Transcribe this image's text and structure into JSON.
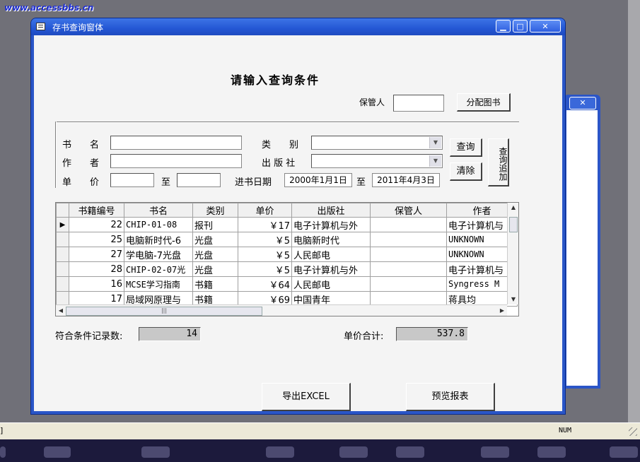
{
  "watermark": "www.accessbbs.cn",
  "window": {
    "title": "存书查询窗体",
    "controls": {
      "minimize": "▁",
      "maximize": "□",
      "close": "✕"
    }
  },
  "bg_window": {
    "close": "✕"
  },
  "form": {
    "heading": "请输入查询条件",
    "custodian_label": "保管人",
    "custodian_value": "",
    "assign_button": "分配图书",
    "book_name_label": "书　　名",
    "author_label": "作　　者",
    "price_label": "单　　价",
    "to_label": "至",
    "category_label": "类　　别",
    "publisher_label": "出 版 社",
    "date_label": "进书日期",
    "date_from": "2000年1月1日",
    "date_to_label": "至",
    "date_to": "2011年4月3日",
    "query_button": "查询",
    "clear_button": "清除",
    "query_append_button": "查询追加"
  },
  "grid": {
    "columns": [
      "书籍编号",
      "书名",
      "类别",
      "单价",
      "出版社",
      "保管人",
      "作者"
    ],
    "rows": [
      {
        "marker": "▶",
        "id": "22",
        "name": "CHIP-01-08",
        "category": "报刊",
        "price": "￥17",
        "publisher": "电子计算机与外",
        "custodian": "",
        "author": "电子计算机与"
      },
      {
        "marker": "",
        "id": "25",
        "name": "电脑新时代-6",
        "category": "光盘",
        "price": "￥5",
        "publisher": "电脑新时代",
        "custodian": "",
        "author": "UNKNOWN"
      },
      {
        "marker": "",
        "id": "27",
        "name": "学电脑-7光盘",
        "category": "光盘",
        "price": "￥5",
        "publisher": "人民邮电",
        "custodian": "",
        "author": "UNKNOWN"
      },
      {
        "marker": "",
        "id": "28",
        "name": "CHIP-02-07光",
        "category": "光盘",
        "price": "￥5",
        "publisher": "电子计算机与外",
        "custodian": "",
        "author": "电子计算机与"
      },
      {
        "marker": "",
        "id": "16",
        "name": "MCSE学习指南",
        "category": "书籍",
        "price": "￥64",
        "publisher": "人民邮电",
        "custodian": "",
        "author": "Syngress M"
      },
      {
        "marker": "",
        "id": "17",
        "name": "局域网原理与",
        "category": "书籍",
        "price": "￥69",
        "publisher": "中国青年",
        "custodian": "",
        "author": "蒋具均"
      }
    ],
    "scroll_up": "▲",
    "scroll_down": "▼",
    "scroll_left": "◀",
    "scroll_right": "▶",
    "thumb_grip": "|||"
  },
  "summary": {
    "count_label": "符合条件记录数:",
    "count_value": "14",
    "total_label": "单价合计:",
    "total_value": "537.8"
  },
  "actions": {
    "export_button": "导出EXCEL",
    "preview_button": "预览报表"
  },
  "statusbar": {
    "num": "NUM",
    "left_mark": "]"
  }
}
